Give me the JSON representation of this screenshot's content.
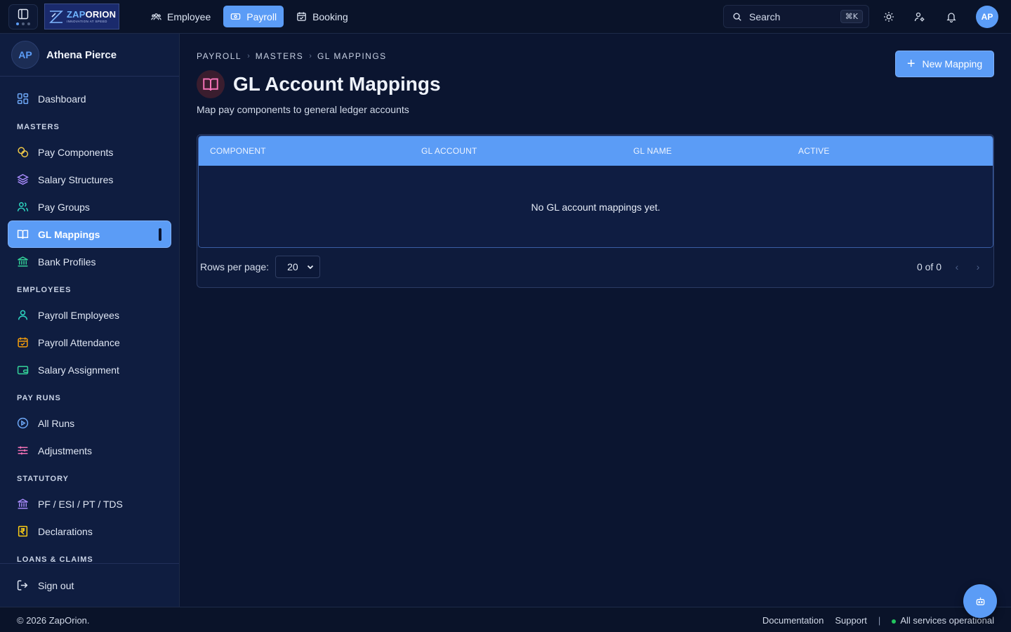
{
  "logo": {
    "brand_a": "ZAP",
    "brand_b": "ORION",
    "tagline": "INNOVATION AT SPEED"
  },
  "modules": [
    {
      "label": "Employee",
      "icon": "users-icon",
      "active": false
    },
    {
      "label": "Payroll",
      "icon": "banknote-icon",
      "active": true
    },
    {
      "label": "Booking",
      "icon": "calendar-check-icon",
      "active": false
    }
  ],
  "search": {
    "label": "Search",
    "shortcut": "⌘K"
  },
  "top_avatar": "AP",
  "user": {
    "initials": "AP",
    "name": "Athena Pierce"
  },
  "sidebar": {
    "dashboard": "Dashboard",
    "masters_label": "MASTERS",
    "masters": [
      "Pay Components",
      "Salary Structures",
      "Pay Groups",
      "GL Mappings",
      "Bank Profiles"
    ],
    "employees_label": "EMPLOYEES",
    "employees": [
      "Payroll Employees",
      "Payroll Attendance",
      "Salary Assignment"
    ],
    "payruns_label": "PAY RUNS",
    "payruns": [
      "All Runs",
      "Adjustments"
    ],
    "statutory_label": "STATUTORY",
    "statutory": [
      "PF / ESI / PT / TDS",
      "Declarations"
    ],
    "loans_label": "LOANS & CLAIMS",
    "signout": "Sign out",
    "active_item": "GL Mappings"
  },
  "breadcrumb": [
    "PAYROLL",
    "MASTERS",
    "GL MAPPINGS"
  ],
  "page": {
    "title": "GL Account Mappings",
    "subtitle": "Map pay components to general ledger accounts",
    "new_button": "New Mapping"
  },
  "table": {
    "columns": [
      "COMPONENT",
      "GL ACCOUNT",
      "GL NAME",
      "ACTIVE"
    ],
    "rows": [],
    "empty_message": "No GL account mappings yet.",
    "rows_per_page_label": "Rows per page:",
    "rows_per_page": "20",
    "range": "0 of 0"
  },
  "footer": {
    "copyright": "© 2026 ZapOrion.",
    "links": [
      "Documentation",
      "Support"
    ],
    "status": "All services operational"
  },
  "colors": {
    "accent": "#5b9cf6",
    "background": "#0b1530",
    "sidebar": "#0f1d40",
    "status_ok": "#22c55e"
  }
}
